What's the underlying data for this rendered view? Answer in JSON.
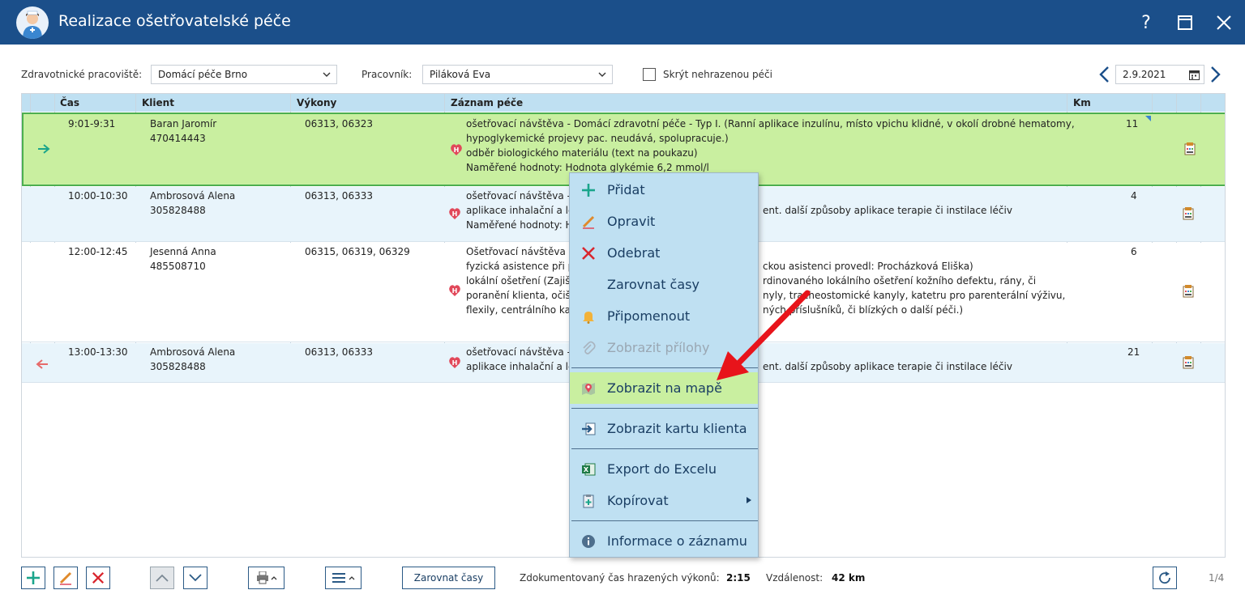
{
  "window": {
    "title": "Realizace ošetřovatelské péče",
    "help": "?",
    "icons": [
      "nurse-avatar-icon",
      "help-icon",
      "maximize-icon",
      "close-icon"
    ]
  },
  "filters": {
    "workplace_label": "Zdravotnické pracoviště:",
    "workplace_value": "Domácí péče Brno",
    "worker_label": "Pracovník:",
    "worker_value": "Piláková Eva",
    "hide_label": "Skrýt nehrazenou péči",
    "hide_checked": false,
    "date": "2.9.2021"
  },
  "grid": {
    "headers": {
      "time": "Čas",
      "client": "Klient",
      "procedures": "Výkony",
      "record": "Záznam péče",
      "km": "Km"
    },
    "rows": [
      {
        "time": "9:01-9:31",
        "client_name": "Baran Jaromír",
        "client_id": "470414443",
        "procedures": "06313, 06323",
        "record": [
          "ošetřovací návštěva - Domácí zdravotní péče - Typ I. (Ranní aplikace inzulínu, místo vpichu klidné, v okolí drobné hematomy,",
          "hypoglykemické projevy pac. neudává, spolupracuje.)",
          "odběr biologického materiálu (text na poukazu)",
          "Naměřené hodnoty: Hodnota glykémie 6,2 mmol/l"
        ],
        "km": "11",
        "marker": "arrow-right-icon",
        "selected": true
      },
      {
        "time": "10:00-10:30",
        "client_name": "Ambrosová Alena",
        "client_id": "305828488",
        "procedures": "06313, 06333",
        "record": [
          "ošetřovací návštěva -",
          "aplikace inhalační a lé",
          "Naměřené hodnoty: H"
        ],
        "record_right": [
          "",
          "ent. další způsoby aplikace terapie či instilace léčiv",
          ""
        ],
        "km": "4",
        "marker": ""
      },
      {
        "time": "12:00-12:45",
        "client_name": "Jesenná Anna",
        "client_id": "485508710",
        "procedures": "06315, 06319, 06329",
        "record": [
          "Ošetřovací návštěva -",
          "fyzická asistence při p",
          "lokální ošetření (Zajiště",
          "poranění klienta, očišt",
          "flexily, centrálního kat"
        ],
        "record_right": [
          "",
          "ckou asistenci provedl: Procházková Eliška)",
          "rdinovaného lokálního ošetření kožního defektu, rány, či",
          "nyly, tracheostomické kanyly, katetru pro parenterální výživu,",
          "ných příslušníků, či blízkých o další péči.)"
        ],
        "km": "6",
        "marker": ""
      },
      {
        "time": "13:00-13:30",
        "client_name": "Ambrosová Alena",
        "client_id": "305828488",
        "procedures": "06313, 06333",
        "record": [
          "ošetřovací návštěva -",
          "aplikace inhalační a lé"
        ],
        "record_right": [
          "",
          "ent. další způsoby aplikace terapie či instilace léčiv"
        ],
        "km": "21",
        "marker": "arrow-left-icon"
      }
    ]
  },
  "context_menu": {
    "items": [
      {
        "label": "Přidat",
        "icon": "plus-icon",
        "enabled": true
      },
      {
        "label": "Opravit",
        "icon": "pencil-icon",
        "enabled": true
      },
      {
        "label": "Odebrat",
        "icon": "x-icon",
        "enabled": true
      },
      {
        "label": "Zarovnat časy",
        "icon": "",
        "enabled": true
      },
      {
        "label": "Připomenout",
        "icon": "bell-icon",
        "enabled": true
      },
      {
        "label": "Zobrazit přílohy",
        "icon": "paperclip-icon",
        "enabled": false
      },
      {
        "label": "Zobrazit na mapě",
        "icon": "map-pin-icon",
        "enabled": true,
        "highlighted": true
      },
      {
        "label": "Zobrazit kartu klienta",
        "icon": "client-card-icon",
        "enabled": true
      },
      {
        "label": "Export do Excelu",
        "icon": "excel-icon",
        "enabled": true
      },
      {
        "label": "Kopírovat",
        "icon": "copy-icon",
        "enabled": true,
        "submenu": true
      },
      {
        "label": "Informace o záznamu",
        "icon": "info-icon",
        "enabled": true
      }
    ]
  },
  "toolbar": {
    "align_label": "Zarovnat časy",
    "documented_label": "Zdokumentovaný čas hrazených výkonů:",
    "documented_value": "2:15",
    "distance_label": "Vzdálenost:",
    "distance_value": "42 km",
    "page": "1/4"
  },
  "colors": {
    "title_bar": "#1b4f8a",
    "header": "#bfe0f2",
    "selected_row": "#c9efa0",
    "selected_border": "#4caf50",
    "alt_row": "#e8f4fb",
    "menu_bg": "#bfe0f2",
    "menu_highlight": "#c9efa0",
    "annotation_arrow": "#e8141b"
  }
}
